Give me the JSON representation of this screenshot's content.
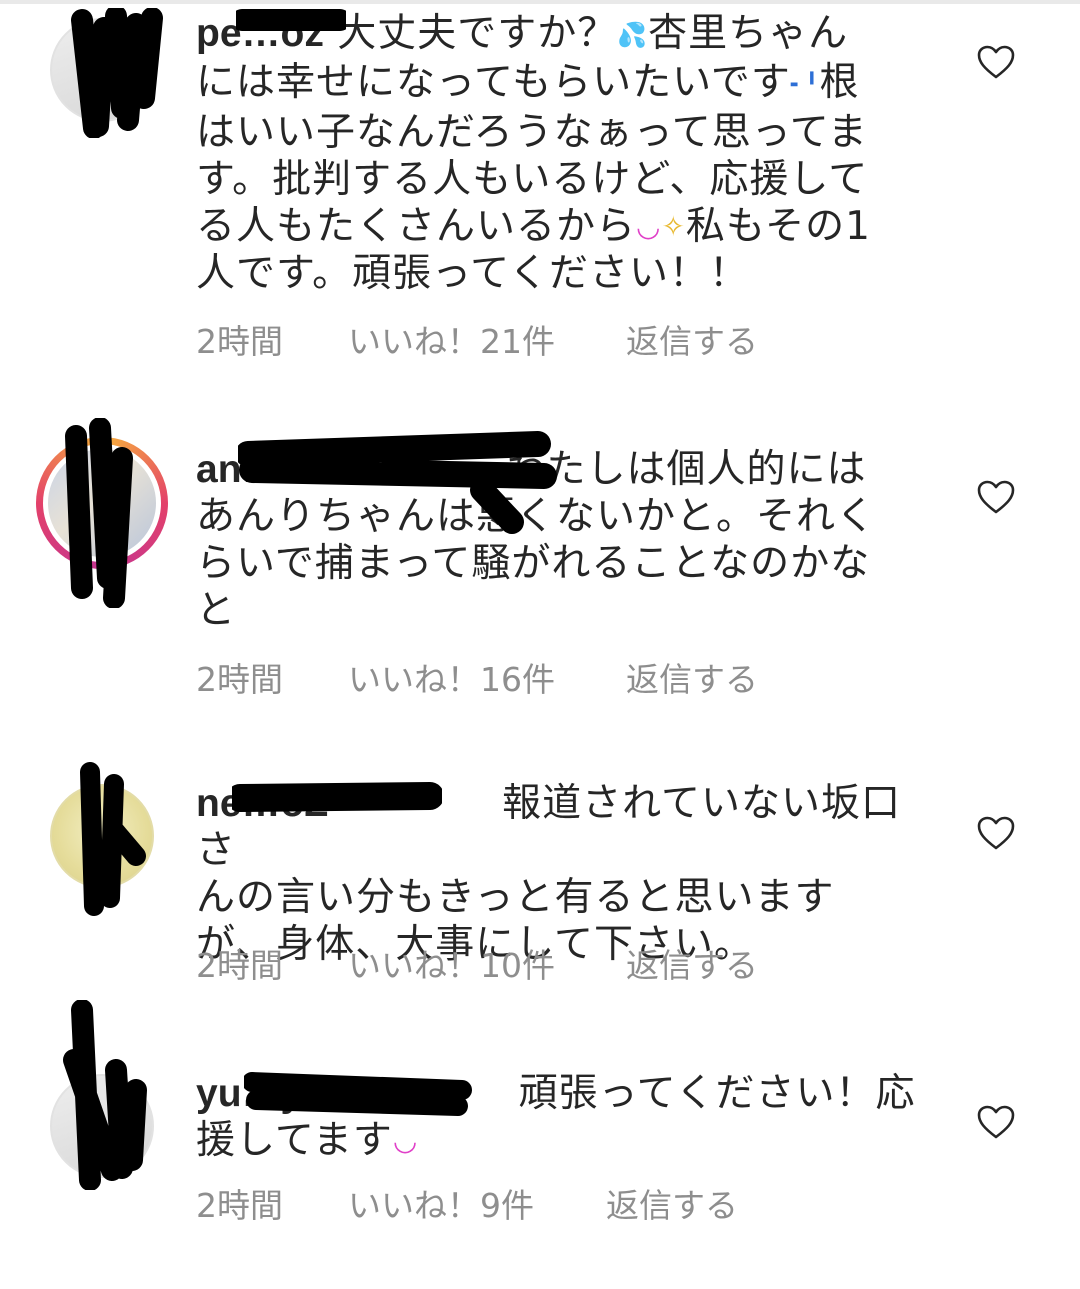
{
  "comments": [
    {
      "username": "pe…oz",
      "lines": [
        "大丈夫ですか？",
        "杏里ちゃん",
        "には幸せになってもらいたいです",
        "根",
        "はいい子なんだろうなぁって思ってま",
        "す。批判する人もいるけど、応援して",
        "る人もたくさんいるから",
        "私もその1",
        "人です。頑張ってください！！"
      ],
      "time": "2時間",
      "likes": "いいね！21件",
      "reply": "返信する",
      "emoji": [
        "sweat-drop",
        "crying-face",
        "smiling-face",
        "sparkles"
      ]
    },
    {
      "username": "an…",
      "lines": [
        "わたしは個人的には",
        "あんりちゃんは悪くないかと。それく",
        "らいで捕まって騒がれることなのかな",
        "と"
      ],
      "time": "2時間",
      "likes": "いいね！16件",
      "reply": "返信する"
    },
    {
      "username": "ne…oZ",
      "lines": [
        "報道されていない坂口さ",
        "んの言い分もきっと有ると思います",
        "が、身体、大事にして下さい。"
      ],
      "time": "2時間",
      "likes": "いいね！10件",
      "reply": "返信する"
    },
    {
      "username": "yu…yuki",
      "lines": [
        "頑張ってください！応",
        "援してます"
      ],
      "time": "2時間",
      "likes": "いいね！9件",
      "reply": "返信する",
      "emoji": [
        "smiling-face"
      ]
    }
  ],
  "icons": {
    "like": "heart-outline-icon",
    "redaction": "black-marker-scribble"
  },
  "colors": {
    "text": "#262626",
    "meta": "#8e8e8e",
    "story_ring": "#e3416a",
    "emoji_pink": "#e040c8",
    "emoji_gold": "#e8b82e"
  }
}
